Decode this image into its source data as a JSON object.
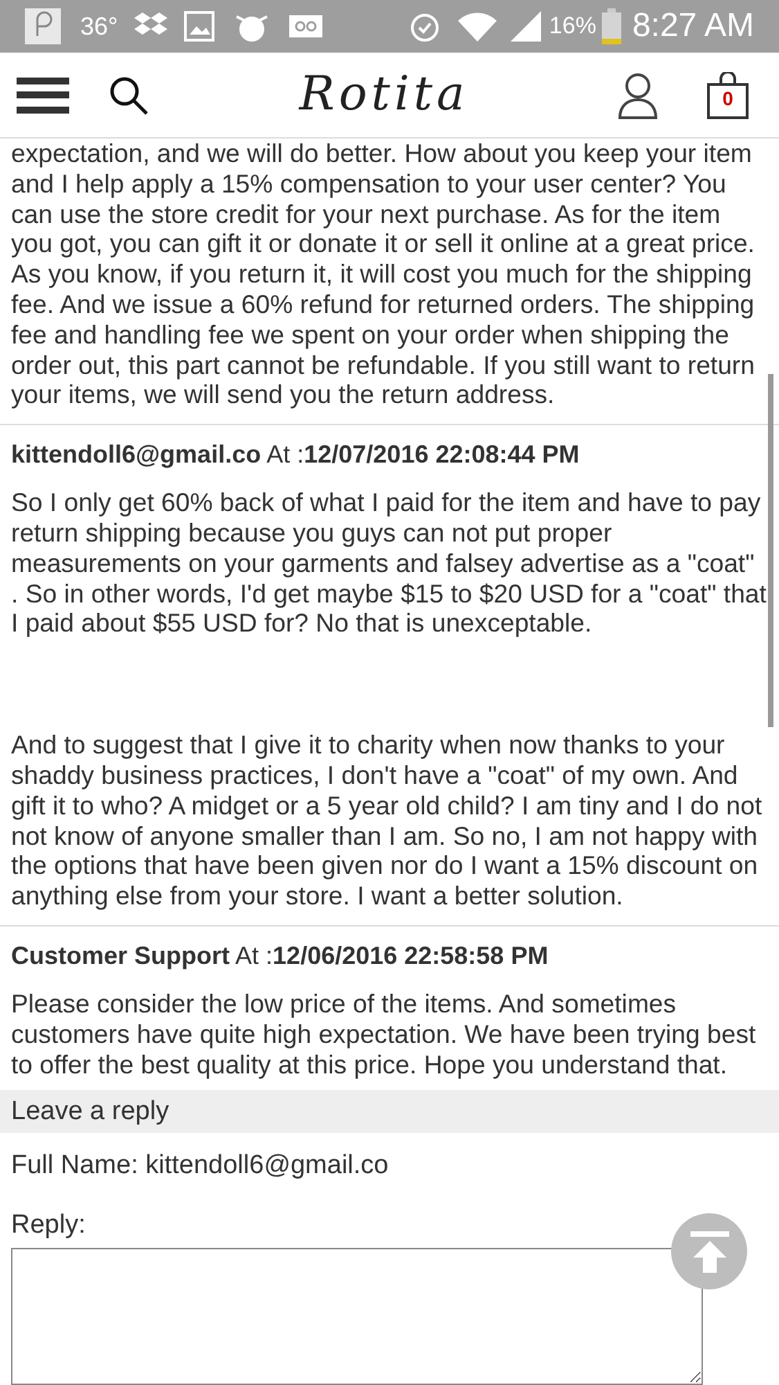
{
  "status_bar": {
    "temperature": "36°",
    "battery": "16%",
    "time": "8:27 AM"
  },
  "header": {
    "logo": "Rotita",
    "cart_count": "0"
  },
  "comments": [
    {
      "paragraphs": [
        "expectation, and we will do better. How about you keep your item and I help apply a 15% compensation to your user center? You can use the store credit for your next purchase. As for the item you got, you can gift it or donate it or sell it online at a great price. As you know, if you return it, it will cost you much for the shipping fee. And we issue a 60% refund for returned orders. The shipping fee and handling fee we spent on your order when shipping the order out, this part cannot be refundable. If you still want to return your items, we will send you the return address."
      ]
    },
    {
      "author": "kittendoll6@gmail.co",
      "at_label": "At :",
      "date": "12/07/2016 22:08:44 PM",
      "paragraphs": [
        "So I only get 60% back of what I paid for the item and have to pay return shipping because you guys can not put proper measurements on your garments and falsey advertise as a \"coat\" . So in other words, I'd get maybe $15 to $20 USD for a \"coat\" that I paid about $55 USD for? No that is unexceptable.",
        "And to suggest that I give it to charity when now thanks to your shaddy business practices, I don't have a \"coat\" of my own. And gift it to who? A midget or a 5 year old child? I am tiny and I do not not know of anyone smaller than I am. So no, I am not happy with the options that have been given nor do I want a 15% discount on anything else from your store. I want a better solution."
      ]
    },
    {
      "author": "Customer Support",
      "at_label": "At :",
      "date": "12/06/2016 22:58:58 PM",
      "paragraphs": [
        "Please consider the low price of the items. And sometimes customers have quite high expectation. We have been trying best to offer the best quality at this price. Hope you understand that."
      ]
    }
  ],
  "reply_form": {
    "title": "Leave a reply",
    "full_name_label": "Full Name:",
    "full_name": "kittendoll6@gmail.co",
    "reply_label": "Reply:"
  }
}
